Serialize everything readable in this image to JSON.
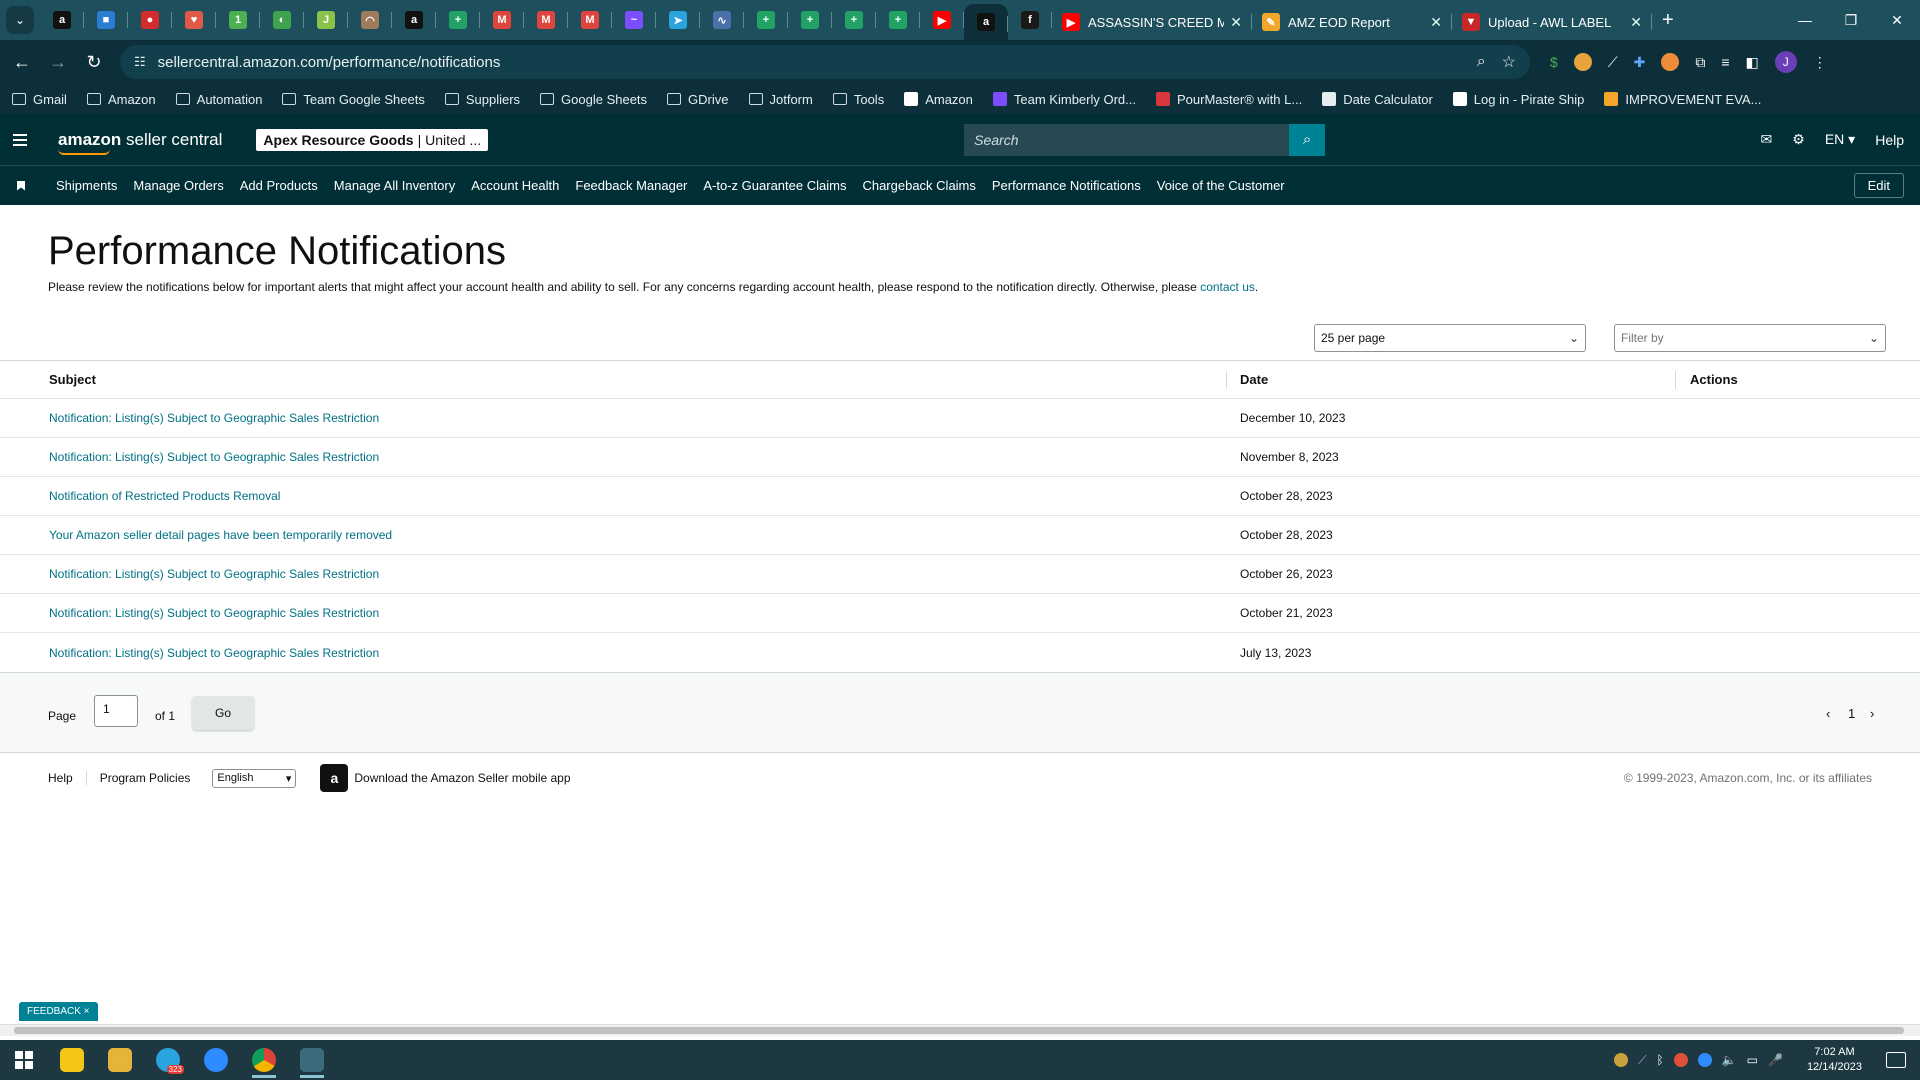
{
  "browser": {
    "pinned_tabs": [
      {
        "icon": "amazon-icon",
        "color": "#111111",
        "glyph": "a"
      },
      {
        "icon": "cube-icon",
        "color": "#2b7cd3",
        "glyph": "■"
      },
      {
        "icon": "red-badge-icon",
        "color": "#d42c2c",
        "glyph": "●"
      },
      {
        "icon": "gift-icon",
        "color": "#e05a4a",
        "glyph": "♥"
      },
      {
        "icon": "number-one-icon",
        "color": "#4caf50",
        "glyph": "1"
      },
      {
        "icon": "headset-icon",
        "color": "#3fa34d",
        "glyph": "◐"
      },
      {
        "icon": "document-icon",
        "color": "#8bc34a",
        "glyph": "J"
      },
      {
        "icon": "rainbow-icon",
        "color": "#9e7b5a",
        "glyph": "◠"
      },
      {
        "icon": "amazon-icon",
        "color": "#111111",
        "glyph": "a"
      },
      {
        "icon": "sheets-icon",
        "color": "#21a366",
        "glyph": "+"
      },
      {
        "icon": "gmail-icon",
        "color": "#e0443e",
        "glyph": "M"
      },
      {
        "icon": "gmail-icon",
        "color": "#e0443e",
        "glyph": "M"
      },
      {
        "icon": "gmail-icon",
        "color": "#e0443e",
        "glyph": "M"
      },
      {
        "icon": "messenger-icon",
        "color": "#7b4dff",
        "glyph": "~"
      },
      {
        "icon": "telegram-icon",
        "color": "#2aa3df",
        "glyph": "➤"
      },
      {
        "icon": "chart-icon",
        "color": "#4b6fa8",
        "glyph": "∿"
      },
      {
        "icon": "sheets-icon",
        "color": "#21a366",
        "glyph": "+"
      },
      {
        "icon": "sheets-icon",
        "color": "#21a366",
        "glyph": "+"
      },
      {
        "icon": "sheets-icon",
        "color": "#21a366",
        "glyph": "+"
      },
      {
        "icon": "sheets-icon",
        "color": "#21a366",
        "glyph": "+"
      },
      {
        "icon": "youtube-icon",
        "color": "#ff0000",
        "glyph": "▶"
      },
      {
        "icon": "amazon-icon",
        "color": "#111111",
        "glyph": "a"
      },
      {
        "icon": "italic-f-icon",
        "color": "#1a1a1a",
        "glyph": "f"
      }
    ],
    "tabs": [
      {
        "title": "ASSASSIN'S CREED MIRA",
        "icon": "youtube-icon",
        "color": "#ff0000",
        "glyph": "▶"
      },
      {
        "title": "AMZ EOD Report",
        "icon": "pen-icon",
        "color": "#f4a62a",
        "glyph": "✎"
      },
      {
        "title": "Upload - AWL LABEL",
        "icon": "shield-icon",
        "color": "#c62828",
        "glyph": "▼"
      }
    ],
    "url": "sellercentral.amazon.com/performance/notifications",
    "bookmarks": [
      {
        "label": "Gmail",
        "icon": "folder-icon"
      },
      {
        "label": "Amazon",
        "icon": "folder-icon"
      },
      {
        "label": "Automation",
        "icon": "folder-icon"
      },
      {
        "label": "Team Google Sheets",
        "icon": "folder-icon"
      },
      {
        "label": "Suppliers",
        "icon": "folder-icon"
      },
      {
        "label": "Google Sheets",
        "icon": "folder-icon"
      },
      {
        "label": "GDrive",
        "icon": "folder-icon"
      },
      {
        "label": "Jotform",
        "icon": "folder-icon"
      },
      {
        "label": "Tools",
        "icon": "folder-icon"
      },
      {
        "label": "Amazon",
        "icon": "amazon-icon"
      },
      {
        "label": "Team Kimberly Ord...",
        "icon": "list-icon"
      },
      {
        "label": "PourMaster® with L...",
        "icon": "pour-icon"
      },
      {
        "label": "Date Calculator",
        "icon": "calendar-icon"
      },
      {
        "label": "Log in - Pirate Ship",
        "icon": "pirate-icon"
      },
      {
        "label": "IMPROVEMENT EVA...",
        "icon": "pen-icon"
      }
    ],
    "profile_initial": "J"
  },
  "header": {
    "logo_bold": "amazon",
    "logo_rest": " seller central",
    "store_name": "Apex Resource Goods",
    "store_region": "| United ...",
    "search_placeholder": "Search",
    "language": "EN",
    "help": "Help"
  },
  "nav": {
    "items": [
      "Shipments",
      "Manage Orders",
      "Add Products",
      "Manage All Inventory",
      "Account Health",
      "Feedback Manager",
      "A-to-z Guarantee Claims",
      "Chargeback Claims",
      "Performance Notifications",
      "Voice of the Customer"
    ],
    "edit": "Edit"
  },
  "page": {
    "title": "Performance Notifications",
    "intro": "Please review the notifications below for important alerts that might affect your account health and ability to sell. For any concerns regarding account health, please respond to the notification directly. Otherwise, please ",
    "intro_link": "contact us",
    "intro_end": ".",
    "per_page": "25 per page",
    "filter_placeholder": "Filter by"
  },
  "table": {
    "headers": {
      "subject": "Subject",
      "date": "Date",
      "actions": "Actions"
    },
    "rows": [
      {
        "subject": "Notification: Listing(s) Subject to Geographic Sales Restriction",
        "date": "December 10, 2023"
      },
      {
        "subject": "Notification: Listing(s) Subject to Geographic Sales Restriction",
        "date": "November 8, 2023"
      },
      {
        "subject": "Notification of Restricted Products Removal",
        "date": "October 28, 2023"
      },
      {
        "subject": "Your Amazon seller detail pages have been temporarily removed",
        "date": "October 28, 2023"
      },
      {
        "subject": "Notification: Listing(s) Subject to Geographic Sales Restriction",
        "date": "October 26, 2023"
      },
      {
        "subject": "Notification: Listing(s) Subject to Geographic Sales Restriction",
        "date": "October 21, 2023"
      },
      {
        "subject": "Notification: Listing(s) Subject to Geographic Sales Restriction",
        "date": "July 13, 2023"
      }
    ]
  },
  "pager": {
    "page_label": "Page",
    "page_value": "1",
    "of_label": "of 1",
    "go": "Go",
    "prev": "‹",
    "current": "1",
    "next": "›"
  },
  "footer": {
    "help": "Help",
    "policies": "Program Policies",
    "language": "English",
    "app": "Download the Amazon Seller mobile app",
    "copyright": "© 1999-2023, Amazon.com, Inc. or its affiliates"
  },
  "feedback": "FEEDBACK ×",
  "taskbar": {
    "time": "7:02 AM",
    "date": "12/14/2023",
    "telegram_badge": "323"
  },
  "colors": {
    "header_bg": "#002f36",
    "link": "#007185",
    "search_button": "#008296"
  }
}
